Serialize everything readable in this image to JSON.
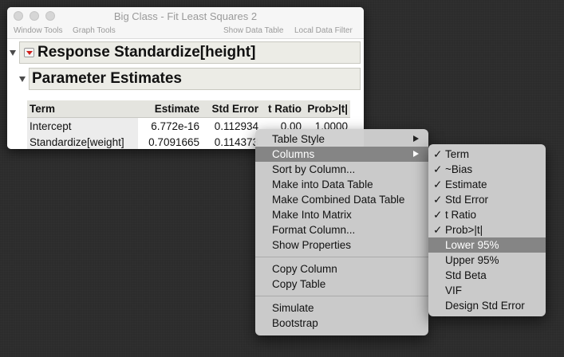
{
  "window": {
    "title": "Big Class - Fit Least Squares 2",
    "menubar": {
      "window_tools": "Window Tools",
      "graph_tools": "Graph Tools",
      "show_data_table": "Show Data Table",
      "local_data_filter": "Local Data Filter"
    }
  },
  "report": {
    "response_title": "Response Standardize[height]",
    "section_title": "Parameter Estimates",
    "columns": [
      "Term",
      "Estimate",
      "Std Error",
      "t Ratio",
      "Prob>|t|"
    ],
    "rows": [
      {
        "term": "Intercept",
        "estimate": "6.772e-16",
        "std_error": "0.112934",
        "t_ratio": "0.00",
        "prob": "1.0000"
      },
      {
        "term": "Standardize[weight]",
        "estimate": "0.7091665",
        "std_error": "0.114373",
        "t_ratio": "",
        "prob": ""
      }
    ]
  },
  "context_menu": {
    "items": [
      {
        "label": "Table Style",
        "submenu": true
      },
      {
        "label": "Columns",
        "submenu": true,
        "highlighted": true
      },
      {
        "label": "Sort by Column..."
      },
      {
        "label": "Make into Data Table"
      },
      {
        "label": "Make Combined Data Table"
      },
      {
        "label": "Make Into Matrix"
      },
      {
        "label": "Format Column..."
      },
      {
        "label": "Show Properties"
      }
    ],
    "group2": [
      {
        "label": "Copy Column"
      },
      {
        "label": "Copy Table"
      }
    ],
    "group3": [
      {
        "label": "Simulate"
      },
      {
        "label": "Bootstrap"
      }
    ]
  },
  "columns_submenu": {
    "check_glyph": "✓",
    "items": [
      {
        "label": "Term",
        "checked": true
      },
      {
        "label": "~Bias",
        "checked": true
      },
      {
        "label": "Estimate",
        "checked": true
      },
      {
        "label": "Std Error",
        "checked": true
      },
      {
        "label": "t Ratio",
        "checked": true
      },
      {
        "label": "Prob>|t|",
        "checked": true
      },
      {
        "label": "Lower 95%",
        "checked": false,
        "highlighted": true
      },
      {
        "label": "Upper 95%",
        "checked": false
      },
      {
        "label": "Std Beta",
        "checked": false
      },
      {
        "label": "VIF",
        "checked": false
      },
      {
        "label": "Design Std Error",
        "checked": false
      }
    ]
  },
  "colors": {
    "highlight": "#858585",
    "red_triangle": "#d0201b",
    "desktop": "#2c2c2c"
  }
}
